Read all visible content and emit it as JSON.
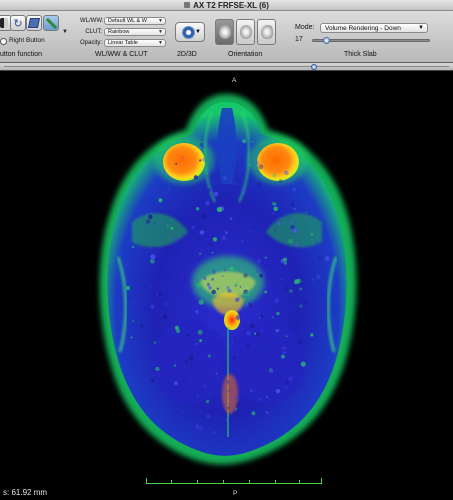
{
  "window": {
    "title": "AX T2 FRFSE-XL (6)"
  },
  "toolbar": {
    "mouse": {
      "group_label": "utton function",
      "right_button_label": "Right Button"
    },
    "wlww": {
      "group_label": "WL/WW & CLUT",
      "wlww_label": "WL/WW:",
      "wlww_value": "Default WL & W",
      "clut_label": "CLUT:",
      "clut_value": "Rainbow",
      "opacity_label": "Opacity:",
      "opacity_value": "Linear Table"
    },
    "dim": {
      "group_label": "2D/3D"
    },
    "orientation": {
      "group_label": "Orientation"
    },
    "thick_slab": {
      "group_label": "Thick Slab",
      "mode_label": "Mode:",
      "mode_value": "Volume Rendering - Down",
      "slab_value": "17",
      "slab_position": 0.12
    }
  },
  "slice_position": 0.7,
  "viewer": {
    "orientation_top": "A",
    "orientation_bottom": "P",
    "scale_readout": "s: 61.92 mm"
  },
  "colors": {
    "clut_low": "#1a1aa8",
    "clut_mid": "#23d06a",
    "clut_high": "#ff7a10",
    "scale_bar": "#4ad04a"
  }
}
